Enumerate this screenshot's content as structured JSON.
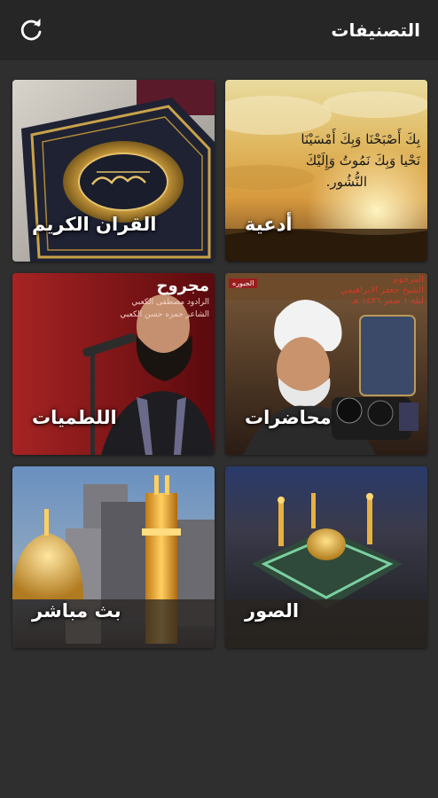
{
  "header": {
    "title": "التصنيفات",
    "refresh_icon": "refresh-icon"
  },
  "categories": [
    {
      "label": "أدعية",
      "image": "sunset-sky-with-quran-verse",
      "verse": [
        "بِكَ أَصْبَحْنَا وَبِكَ أَمْسَيْنَا",
        "نَحْيا وَبِكَ نَمُوتُ وَإِلَيْكَ",
        "النُّشُور."
      ]
    },
    {
      "label": "القران الكريم",
      "image": "ornate-quran-book-cover"
    },
    {
      "label": "محاضرات",
      "image": "cleric-speaking-at-microphones",
      "banner": [
        "المرحوم",
        "الشيخ جعفر الابراهيمي",
        "ليلة ١ صفر ١٤٣٦ هـ"
      ],
      "tag": "الجبوره"
    },
    {
      "label": "اللطميات",
      "image": "reciter-at-microphone",
      "banner": [
        "مجروح",
        "الرادود مصطفى الكعبي",
        "الشاعر حمزه حسن الكعبي"
      ]
    },
    {
      "label": "الصور",
      "image": "illuminated-shrine-aerial-night"
    },
    {
      "label": "بث مباشر",
      "image": "golden-dome-and-minaret-at-dusk"
    }
  ],
  "colors": {
    "background": "#2f2f2f",
    "topbar": "#262626",
    "text": "#ffffff"
  }
}
